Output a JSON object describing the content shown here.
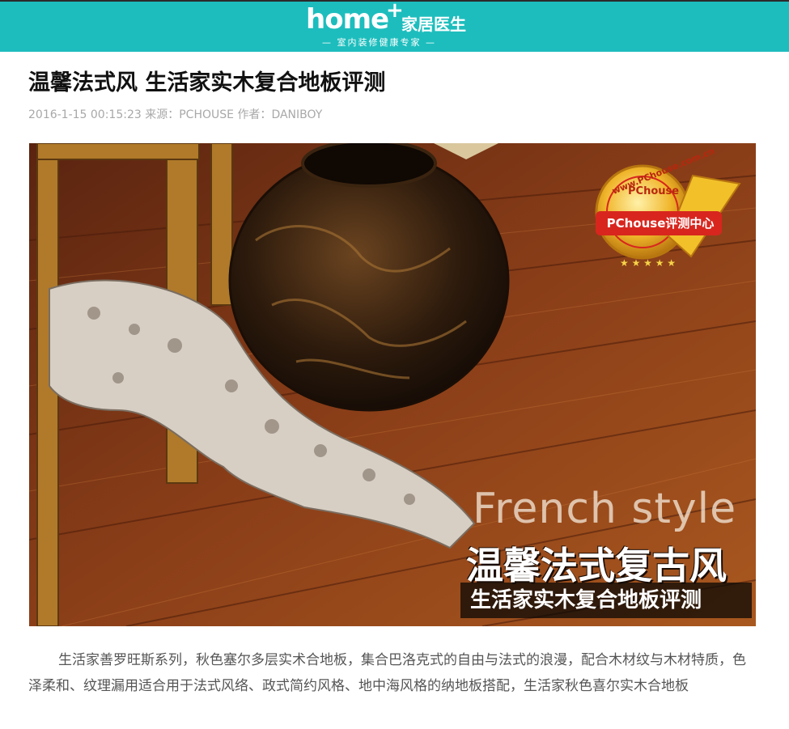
{
  "header": {
    "logo_main": "home",
    "logo_plus": "+",
    "logo_cn": "家居医生",
    "logo_tagline": "— 室内装修健康专家 —"
  },
  "article": {
    "title": "温馨法式风 生活家实木复合地板评测",
    "date": "2016-1-15 00:15:23",
    "source_label": "来源：",
    "source": "PCHOUSE",
    "author_label": "作者：",
    "author": "DANIBOY",
    "paragraph": "生活家善罗旺斯系列，秋色塞尔多层实术合地板，集合巴洛克式的自由与法式的浪漫，配合木材纹与木材特质，色泽柔和、纹理漏用适合用于法式风络、政式简约风格、地中海风格的纳地板搭配，生活家秋色喜尔实木合地板"
  },
  "hero": {
    "badge_url": "www.PChouse.com.cn",
    "badge_brand": "PChouse",
    "badge_ribbon": "PChouse评测中心",
    "overlay_en": "French style",
    "overlay_cn": "温馨法式复古风",
    "overlay_sub": "生活家实木复合地板评测"
  },
  "colors": {
    "header_bg": "#1dbdbd",
    "badge_red": "#d8261e",
    "badge_gold": "#e8a81a"
  }
}
